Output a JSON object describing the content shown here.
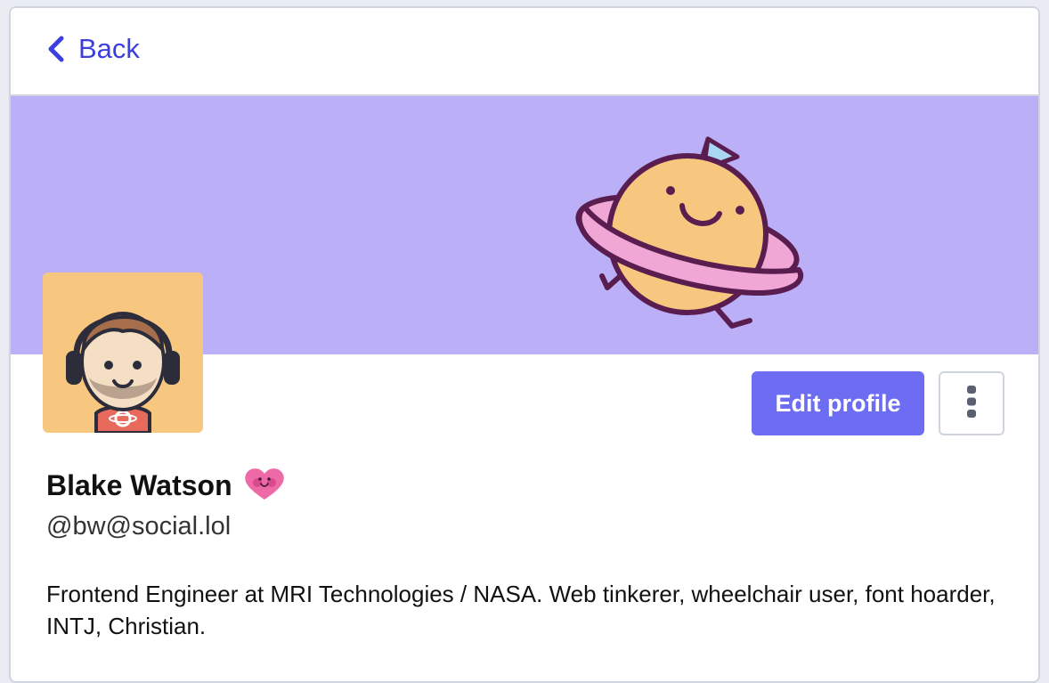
{
  "nav": {
    "back_label": "Back"
  },
  "profile": {
    "display_name": "Blake Watson",
    "handle": "@bw@social.lol",
    "bio": "Frontend Engineer at MRI Technologies / NASA. Web tinkerer, wheelchair user, font hoarder, INTJ, Christian."
  },
  "actions": {
    "edit_profile_label": "Edit profile"
  },
  "icons": {
    "back": "chevron-left-icon",
    "more": "vertical-dots-icon",
    "name_emoji": "smiling-heart-icon"
  },
  "colors": {
    "accent": "#6d6df3",
    "link": "#3b3fdd",
    "banner": "#bbaff7",
    "avatar_bg": "#f7c67f"
  }
}
